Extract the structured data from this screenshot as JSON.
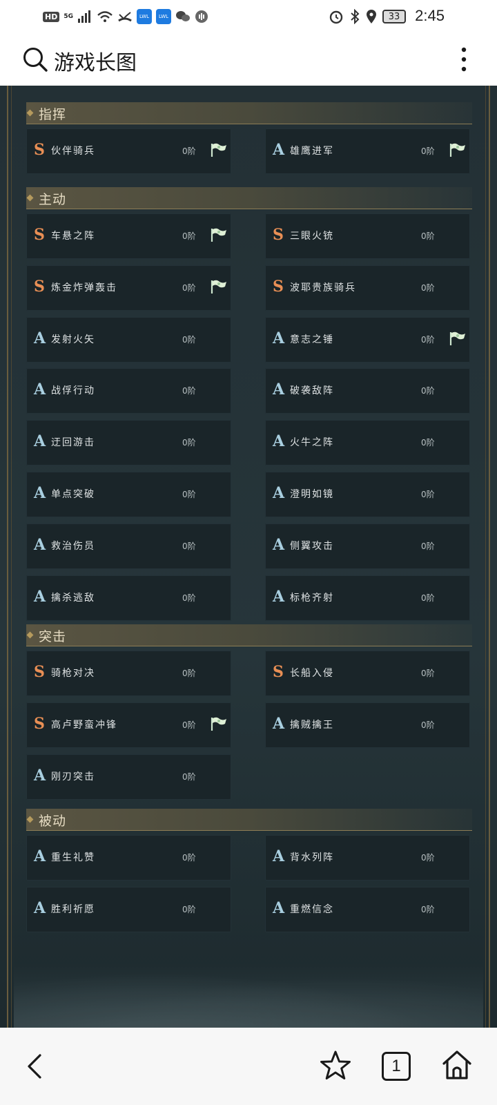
{
  "status_bar": {
    "hd": "HD",
    "network": "5G",
    "app_badges": [
      "LWL",
      "LWL"
    ],
    "battery": "33",
    "time": "2:45"
  },
  "search": {
    "query": "游戏长图"
  },
  "sections": [
    {
      "title": "指挥",
      "skills": [
        {
          "grade": "S",
          "name": "伙伴骑兵",
          "level": "0阶",
          "flag": true
        },
        {
          "grade": "A",
          "name": "雄鹰进军",
          "level": "0阶",
          "flag": true
        }
      ]
    },
    {
      "title": "主动",
      "skills": [
        {
          "grade": "S",
          "name": "车悬之阵",
          "level": "0阶",
          "flag": true
        },
        {
          "grade": "S",
          "name": "三眼火铳",
          "level": "0阶",
          "flag": false
        },
        {
          "grade": "S",
          "name": "炼金炸弹轰击",
          "level": "0阶",
          "flag": true
        },
        {
          "grade": "S",
          "name": "波耶贵族骑兵",
          "level": "0阶",
          "flag": false
        },
        {
          "grade": "A",
          "name": "发射火矢",
          "level": "0阶",
          "flag": false
        },
        {
          "grade": "A",
          "name": "意志之锤",
          "level": "0阶",
          "flag": true
        },
        {
          "grade": "A",
          "name": "战俘行动",
          "level": "0阶",
          "flag": false
        },
        {
          "grade": "A",
          "name": "破袭敌阵",
          "level": "0阶",
          "flag": false
        },
        {
          "grade": "A",
          "name": "迂回游击",
          "level": "0阶",
          "flag": false
        },
        {
          "grade": "A",
          "name": "火牛之阵",
          "level": "0阶",
          "flag": false
        },
        {
          "grade": "A",
          "name": "单点突破",
          "level": "0阶",
          "flag": false
        },
        {
          "grade": "A",
          "name": "澄明如镜",
          "level": "0阶",
          "flag": false
        },
        {
          "grade": "A",
          "name": "救治伤员",
          "level": "0阶",
          "flag": false
        },
        {
          "grade": "A",
          "name": "侧翼攻击",
          "level": "0阶",
          "flag": false
        },
        {
          "grade": "A",
          "name": "擒杀逃敌",
          "level": "0阶",
          "flag": false
        },
        {
          "grade": "A",
          "name": "标枪齐射",
          "level": "0阶",
          "flag": false
        }
      ]
    },
    {
      "title": "突击",
      "skills": [
        {
          "grade": "S",
          "name": "骑枪对决",
          "level": "0阶",
          "flag": false
        },
        {
          "grade": "S",
          "name": "长船入侵",
          "level": "0阶",
          "flag": false
        },
        {
          "grade": "S",
          "name": "高卢野蛮冲锋",
          "level": "0阶",
          "flag": true
        },
        {
          "grade": "A",
          "name": "擒贼擒王",
          "level": "0阶",
          "flag": false
        },
        {
          "grade": "A",
          "name": "刚刃突击",
          "level": "0阶",
          "flag": false
        }
      ]
    },
    {
      "title": "被动",
      "skills": [
        {
          "grade": "A",
          "name": "重生礼赞",
          "level": "0阶",
          "flag": false
        },
        {
          "grade": "A",
          "name": "背水列阵",
          "level": "0阶",
          "flag": false
        },
        {
          "grade": "A",
          "name": "胜利祈愿",
          "level": "0阶",
          "flag": false
        },
        {
          "grade": "A",
          "name": "重燃信念",
          "level": "0阶",
          "flag": false
        }
      ]
    }
  ],
  "bottom_nav": {
    "tab_count": "1",
    "icons": [
      "back-icon",
      "star-icon",
      "tabs-icon",
      "home-icon"
    ]
  },
  "colors": {
    "grade_S": "#e98f55",
    "grade_A": "#a9cfe0",
    "card_bg": "#1a2529",
    "section_header": "#5a5542",
    "gold_border": "#8d7d55"
  }
}
